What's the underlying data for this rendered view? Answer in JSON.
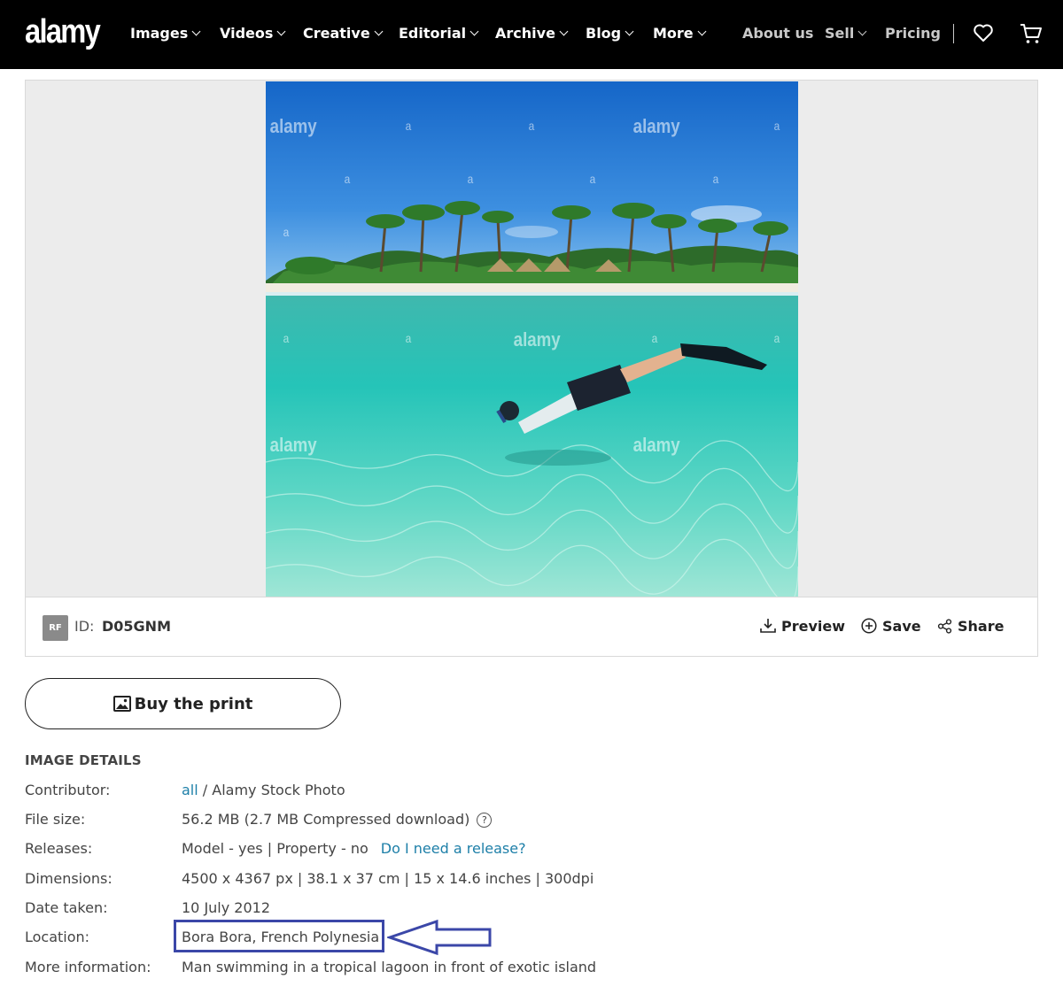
{
  "header": {
    "logo": "alamy",
    "nav": [
      {
        "label": "Images",
        "has_menu": true
      },
      {
        "label": "Videos",
        "has_menu": true
      },
      {
        "label": "Creative",
        "has_menu": true
      },
      {
        "label": "Editorial",
        "has_menu": true
      },
      {
        "label": "Archive",
        "has_menu": true
      },
      {
        "label": "Blog",
        "has_menu": true
      },
      {
        "label": "More",
        "has_menu": true
      }
    ],
    "secondary_nav": [
      {
        "label": "About us",
        "has_menu": false
      },
      {
        "label": "Sell",
        "has_menu": true
      },
      {
        "label": "Pricing",
        "has_menu": false
      }
    ],
    "icons": [
      "heart-icon",
      "cart-icon"
    ]
  },
  "viewer": {
    "watermark": "alamy",
    "watermark_small": "a",
    "badge": "RF",
    "id_label": "ID:",
    "id_value": "D05GNM",
    "actions": {
      "preview": "Preview",
      "save": "Save",
      "share": "Share"
    }
  },
  "buy_button": "Buy the print",
  "details": {
    "title": "IMAGE DETAILS",
    "contributor": {
      "label": "Contributor:",
      "link": "all",
      "rest": " / Alamy Stock Photo"
    },
    "file_size": {
      "label": "File size:",
      "value": "56.2 MB (2.7 MB Compressed download)",
      "help": "?"
    },
    "releases": {
      "label": "Releases:",
      "value": "Model - yes | Property - no",
      "link": "Do I need a release?"
    },
    "dimensions": {
      "label": "Dimensions:",
      "value": "4500 x 4367 px | 38.1 x 37 cm | 15 x 14.6 inches | 300dpi"
    },
    "date_taken": {
      "label": "Date taken:",
      "value": "10 July 2012"
    },
    "location": {
      "label": "Location:",
      "value": "Bora Bora, French Polynesia"
    },
    "more_info": {
      "label": "More information:",
      "value": "Man swimming in a tropical lagoon in front of exotic island"
    }
  },
  "colors": {
    "header_bg": "#000000",
    "link": "#1d7fa8",
    "annotation": "#3b47a8"
  }
}
